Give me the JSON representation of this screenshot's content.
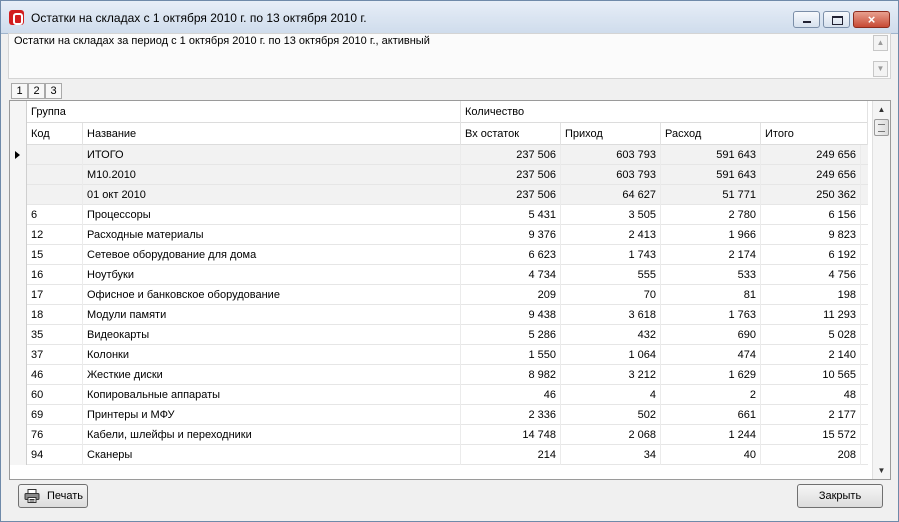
{
  "window": {
    "title": "Остатки на складах с 1 октября 2010 г. по 13 октября 2010 г.",
    "controls": {
      "close_glyph": "×"
    }
  },
  "description": "Остатки на складах за период с 1 октября 2010 г. по 13 октября 2010 г., активный",
  "tabs": [
    "1",
    "2",
    "3"
  ],
  "grid": {
    "header_top": {
      "group": "Группа",
      "quantity": "Количество"
    },
    "header_bottom": {
      "code": "Код",
      "name": "Название",
      "start": "Вх остаток",
      "in": "Приход",
      "out": "Расход",
      "total": "Итого"
    },
    "rows": [
      {
        "code": "",
        "name": "ИТОГО",
        "start": "237 506",
        "in": "603 793",
        "out": "591 643",
        "total": "249 656",
        "summary": true,
        "current": true
      },
      {
        "code": "",
        "name": "M10.2010",
        "start": "237 506",
        "in": "603 793",
        "out": "591 643",
        "total": "249 656",
        "summary": true
      },
      {
        "code": "",
        "name": "01 окт 2010",
        "start": "237 506",
        "in": "64 627",
        "out": "51 771",
        "total": "250 362",
        "summary": true
      },
      {
        "code": "6",
        "name": "Процессоры",
        "start": "5 431",
        "in": "3 505",
        "out": "2 780",
        "total": "6 156"
      },
      {
        "code": "12",
        "name": "Расходные материалы",
        "start": "9 376",
        "in": "2 413",
        "out": "1 966",
        "total": "9 823"
      },
      {
        "code": "15",
        "name": "Сетевое оборудование для дома",
        "start": "6 623",
        "in": "1 743",
        "out": "2 174",
        "total": "6 192"
      },
      {
        "code": "16",
        "name": "Ноутбуки",
        "start": "4 734",
        "in": "555",
        "out": "533",
        "total": "4 756"
      },
      {
        "code": "17",
        "name": "Офисное и банковское оборудование",
        "start": "209",
        "in": "70",
        "out": "81",
        "total": "198"
      },
      {
        "code": "18",
        "name": "Модули памяти",
        "start": "9 438",
        "in": "3 618",
        "out": "1 763",
        "total": "11 293"
      },
      {
        "code": "35",
        "name": "Видеокарты",
        "start": "5 286",
        "in": "432",
        "out": "690",
        "total": "5 028"
      },
      {
        "code": "37",
        "name": "Колонки",
        "start": "1 550",
        "in": "1 064",
        "out": "474",
        "total": "2 140"
      },
      {
        "code": "46",
        "name": "Жесткие диски",
        "start": "8 982",
        "in": "3 212",
        "out": "1 629",
        "total": "10 565"
      },
      {
        "code": "60",
        "name": "Копировальные аппараты",
        "start": "46",
        "in": "4",
        "out": "2",
        "total": "48"
      },
      {
        "code": "69",
        "name": "Принтеры и МФУ",
        "start": "2 336",
        "in": "502",
        "out": "661",
        "total": "2 177"
      },
      {
        "code": "76",
        "name": "Кабели, шлейфы и переходники",
        "start": "14 748",
        "in": "2 068",
        "out": "1 244",
        "total": "15 572"
      },
      {
        "code": "94",
        "name": "Сканеры",
        "start": "214",
        "in": "34",
        "out": "40",
        "total": "208"
      }
    ]
  },
  "buttons": {
    "print": "Печать",
    "close": "Закрыть"
  },
  "icons": {
    "app": "app-logo-icon",
    "print": "printer-icon"
  }
}
